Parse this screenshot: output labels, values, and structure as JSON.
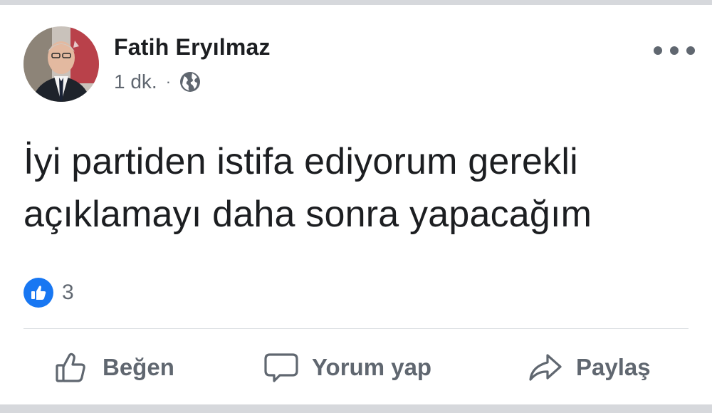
{
  "post": {
    "author": {
      "name": "Fatih Eryılmaz",
      "avatar": "avatar-photo"
    },
    "meta": {
      "time": "1 dk.",
      "separator": "·",
      "privacy_icon": "globe-icon"
    },
    "more_icon": "more-horizontal-icon",
    "text_lines": [
      "İyi partiden istifa ediyorum gerekli",
      "açıklamayı daha sonra yapacağım"
    ],
    "reactions": {
      "icon": "like-reaction-icon",
      "count": "3"
    },
    "actions": [
      {
        "label": "Beğen",
        "icon": "thumbs-up-icon"
      },
      {
        "label": "Yorum yap",
        "icon": "comment-icon"
      },
      {
        "label": "Paylaş",
        "icon": "share-icon"
      }
    ]
  },
  "colors": {
    "text_primary": "#1c1e21",
    "text_secondary": "#606770",
    "like_blue": "#1877f2",
    "divider": "#dadde1",
    "frame_bar": "#d6d8dc"
  }
}
